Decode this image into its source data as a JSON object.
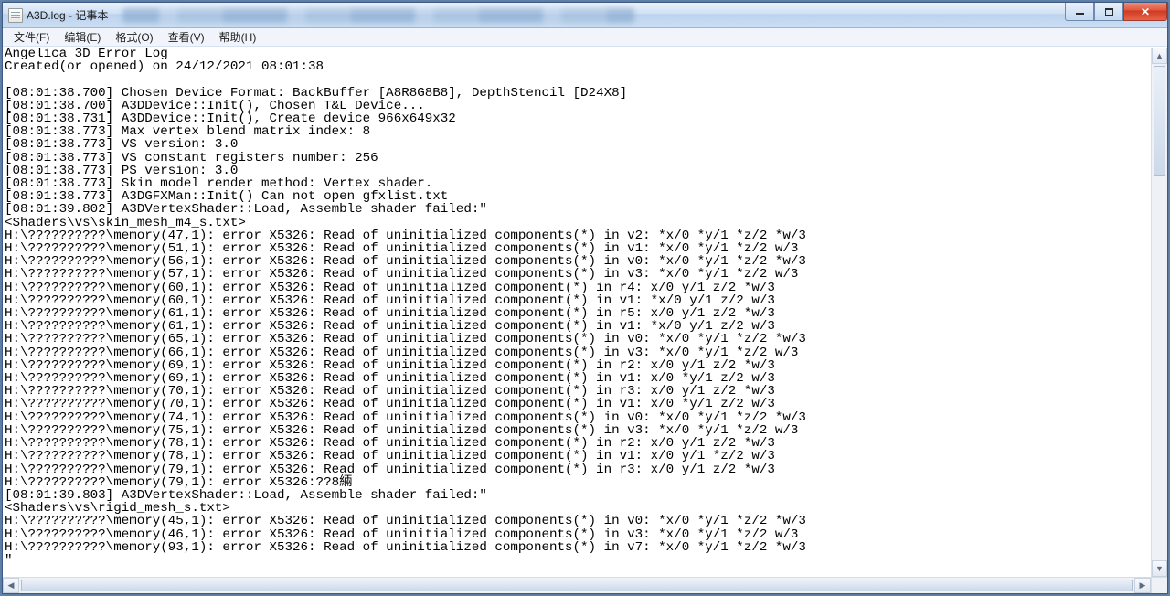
{
  "window": {
    "title": "A3D.log - 记事本"
  },
  "menus": {
    "file": "文件(F)",
    "edit": "编辑(E)",
    "format": "格式(O)",
    "view": "查看(V)",
    "help": "帮助(H)"
  },
  "log": {
    "lines": [
      "Angelica 3D Error Log",
      "Created(or opened) on 24/12/2021 08:01:38",
      "",
      "[08:01:38.700] Chosen Device Format: BackBuffer [A8R8G8B8], DepthStencil [D24X8]",
      "[08:01:38.700] A3DDevice::Init(), Chosen T&L Device...",
      "[08:01:38.731] A3DDevice::Init(), Create device 966x649x32",
      "[08:01:38.773] Max vertex blend matrix index: 8",
      "[08:01:38.773] VS version: 3.0",
      "[08:01:38.773] VS constant registers number: 256",
      "[08:01:38.773] PS version: 3.0",
      "[08:01:38.773] Skin model render method: Vertex shader.",
      "[08:01:38.773] A3DGFXMan::Init() Can not open gfxlist.txt",
      "[08:01:39.802] A3DVertexShader::Load, Assemble shader failed:\"",
      "<Shaders\\vs\\skin_mesh_m4_s.txt>",
      "H:\\??????????\\memory(47,1): error X5326: Read of uninitialized components(*) in v2: *x/0 *y/1 *z/2 *w/3",
      "H:\\??????????\\memory(51,1): error X5326: Read of uninitialized components(*) in v1: *x/0 *y/1 *z/2 w/3",
      "H:\\??????????\\memory(56,1): error X5326: Read of uninitialized components(*) in v0: *x/0 *y/1 *z/2 *w/3",
      "H:\\??????????\\memory(57,1): error X5326: Read of uninitialized components(*) in v3: *x/0 *y/1 *z/2 w/3",
      "H:\\??????????\\memory(60,1): error X5326: Read of uninitialized component(*) in r4: x/0 y/1 z/2 *w/3",
      "H:\\??????????\\memory(60,1): error X5326: Read of uninitialized component(*) in v1: *x/0 y/1 z/2 w/3",
      "H:\\??????????\\memory(61,1): error X5326: Read of uninitialized component(*) in r5: x/0 y/1 z/2 *w/3",
      "H:\\??????????\\memory(61,1): error X5326: Read of uninitialized component(*) in v1: *x/0 y/1 z/2 w/3",
      "H:\\??????????\\memory(65,1): error X5326: Read of uninitialized components(*) in v0: *x/0 *y/1 *z/2 *w/3",
      "H:\\??????????\\memory(66,1): error X5326: Read of uninitialized components(*) in v3: *x/0 *y/1 *z/2 w/3",
      "H:\\??????????\\memory(69,1): error X5326: Read of uninitialized component(*) in r2: x/0 y/1 z/2 *w/3",
      "H:\\??????????\\memory(69,1): error X5326: Read of uninitialized component(*) in v1: x/0 *y/1 z/2 w/3",
      "H:\\??????????\\memory(70,1): error X5326: Read of uninitialized component(*) in r3: x/0 y/1 z/2 *w/3",
      "H:\\??????????\\memory(70,1): error X5326: Read of uninitialized component(*) in v1: x/0 *y/1 z/2 w/3",
      "H:\\??????????\\memory(74,1): error X5326: Read of uninitialized components(*) in v0: *x/0 *y/1 *z/2 *w/3",
      "H:\\??????????\\memory(75,1): error X5326: Read of uninitialized components(*) in v3: *x/0 *y/1 *z/2 w/3",
      "H:\\??????????\\memory(78,1): error X5326: Read of uninitialized component(*) in r2: x/0 y/1 z/2 *w/3",
      "H:\\??????????\\memory(78,1): error X5326: Read of uninitialized component(*) in v1: x/0 y/1 *z/2 w/3",
      "H:\\??????????\\memory(79,1): error X5326: Read of uninitialized component(*) in r3: x/0 y/1 z/2 *w/3",
      "H:\\??????????\\memory(79,1): error X5326:??8緉",
      "[08:01:39.803] A3DVertexShader::Load, Assemble shader failed:\"",
      "<Shaders\\vs\\rigid_mesh_s.txt>",
      "H:\\??????????\\memory(45,1): error X5326: Read of uninitialized components(*) in v0: *x/0 *y/1 *z/2 *w/3",
      "H:\\??????????\\memory(46,1): error X5326: Read of uninitialized components(*) in v3: *x/0 *y/1 *z/2 w/3",
      "H:\\??????????\\memory(93,1): error X5326: Read of uninitialized components(*) in v7: *x/0 *y/1 *z/2 *w/3",
      "\""
    ]
  }
}
